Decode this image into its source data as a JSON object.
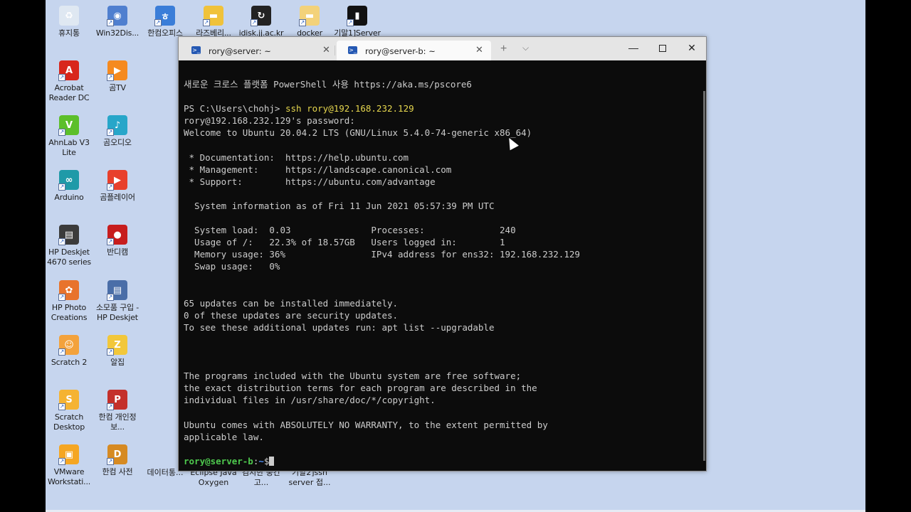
{
  "desktop": {
    "icons_top": [
      {
        "label": "휴지통",
        "icon": "recycle-bin-icon",
        "color": "#dfe8f2"
      },
      {
        "label": "Win32Dis...",
        "icon": "disk-imager-icon",
        "color": "#4f7fcf"
      },
      {
        "label": "한컴오피스",
        "icon": "hancom-office-icon",
        "color": "#3a7dd8"
      },
      {
        "label": "라즈베리...",
        "icon": "folder-icon",
        "color": "#f0c23a"
      },
      {
        "label": "idisk.jj.ac.kr",
        "icon": "network-drive-icon",
        "color": "#222222"
      },
      {
        "label": "docker",
        "icon": "folder-icon",
        "color": "#f3d27a"
      },
      {
        "label": "기말1]Server",
        "icon": "terminal-shortcut-icon",
        "color": "#111111"
      }
    ],
    "icons_col1": [
      {
        "label": "Acrobat Reader DC",
        "icon": "acrobat-icon",
        "color": "#d8261c"
      },
      {
        "label": "AhnLab V3 Lite",
        "icon": "ahnlab-icon",
        "color": "#5cbf2a"
      },
      {
        "label": "Arduino",
        "icon": "arduino-icon",
        "color": "#1f9aa8"
      },
      {
        "label": "HP Deskjet 4670 series",
        "icon": "printer-icon",
        "color": "#3b3b3b"
      },
      {
        "label": "HP Photo Creations",
        "icon": "hp-photo-icon",
        "color": "#e8732c"
      },
      {
        "label": "Scratch 2",
        "icon": "scratch-cat-icon",
        "color": "#f3a23c"
      },
      {
        "label": "Scratch Desktop",
        "icon": "scratch-desktop-icon",
        "color": "#f5b332"
      },
      {
        "label": "VMware Workstati...",
        "icon": "vmware-icon",
        "color": "#f5a623"
      }
    ],
    "icons_col2": [
      {
        "label": "곰TV",
        "icon": "gomtv-icon",
        "color": "#f58a1f"
      },
      {
        "label": "곰오디오",
        "icon": "gomaudio-icon",
        "color": "#27a6c9"
      },
      {
        "label": "곰플레이어",
        "icon": "gomplayer-icon",
        "color": "#e8402c"
      },
      {
        "label": "반디캠",
        "icon": "bandicam-icon",
        "color": "#c71d1d"
      },
      {
        "label": "소모품 구입 - HP Deskjet",
        "icon": "supplies-icon",
        "color": "#4a6ea8"
      },
      {
        "label": "알집",
        "icon": "alzip-icon",
        "color": "#f2c73a"
      },
      {
        "label": "한컴 개인정보...",
        "icon": "hancom-privacy-icon",
        "color": "#c4302b"
      },
      {
        "label": "한컴 사전",
        "icon": "hancom-dict-icon",
        "color": "#d68a22"
      }
    ],
    "icons_bottom": [
      {
        "label": "데이터통...",
        "icon": "data-icon"
      },
      {
        "label": "Eclipse Java Oxygen",
        "icon": "eclipse-icon"
      },
      {
        "label": "김지한 중간고...",
        "icon": "document-icon"
      },
      {
        "label": "기말2]ssh server 접...",
        "icon": "terminal-shortcut-icon"
      }
    ]
  },
  "window": {
    "tabs": [
      {
        "title": "rory@server: ~",
        "active": false
      },
      {
        "title": "rory@server-b: ~",
        "active": true
      }
    ],
    "new_tab": "+",
    "dropdown": "⌵",
    "minimize": "—",
    "close": "✕"
  },
  "terminal": {
    "lines": [
      "새로운 크로스 플랫폼 PowerShell 사용 https://aka.ms/pscore6",
      "",
      "",
      "rory@192.168.232.129's password:",
      "Welcome to Ubuntu 20.04.2 LTS (GNU/Linux 5.4.0-74-generic x86_64)",
      "",
      " * Documentation:  https://help.ubuntu.com",
      " * Management:     https://landscape.canonical.com",
      " * Support:        https://ubuntu.com/advantage",
      "",
      "  System information as of Fri 11 Jun 2021 05:57:39 PM UTC",
      "",
      "  System load:  0.03               Processes:              240",
      "  Usage of /:   22.3% of 18.57GB   Users logged in:        1",
      "  Memory usage: 36%                IPv4 address for ens32: 192.168.232.129",
      "  Swap usage:   0%",
      "",
      "",
      "65 updates can be installed immediately.",
      "0 of these updates are security updates.",
      "To see these additional updates run: apt list --upgradable",
      "",
      "",
      "",
      "The programs included with the Ubuntu system are free software;",
      "the exact distribution terms for each program are described in the",
      "individual files in /usr/share/doc/*/copyright.",
      "",
      "Ubuntu comes with ABSOLUTELY NO WARRANTY, to the extent permitted by",
      "applicable law.",
      ""
    ],
    "ps_prompt": "PS C:\\Users\\chohj> ",
    "ps_command": "ssh rory@192.168.232.129",
    "shell_user": "rory@server-b",
    "shell_sep": ":",
    "shell_path": "~",
    "shell_symbol": "$"
  }
}
